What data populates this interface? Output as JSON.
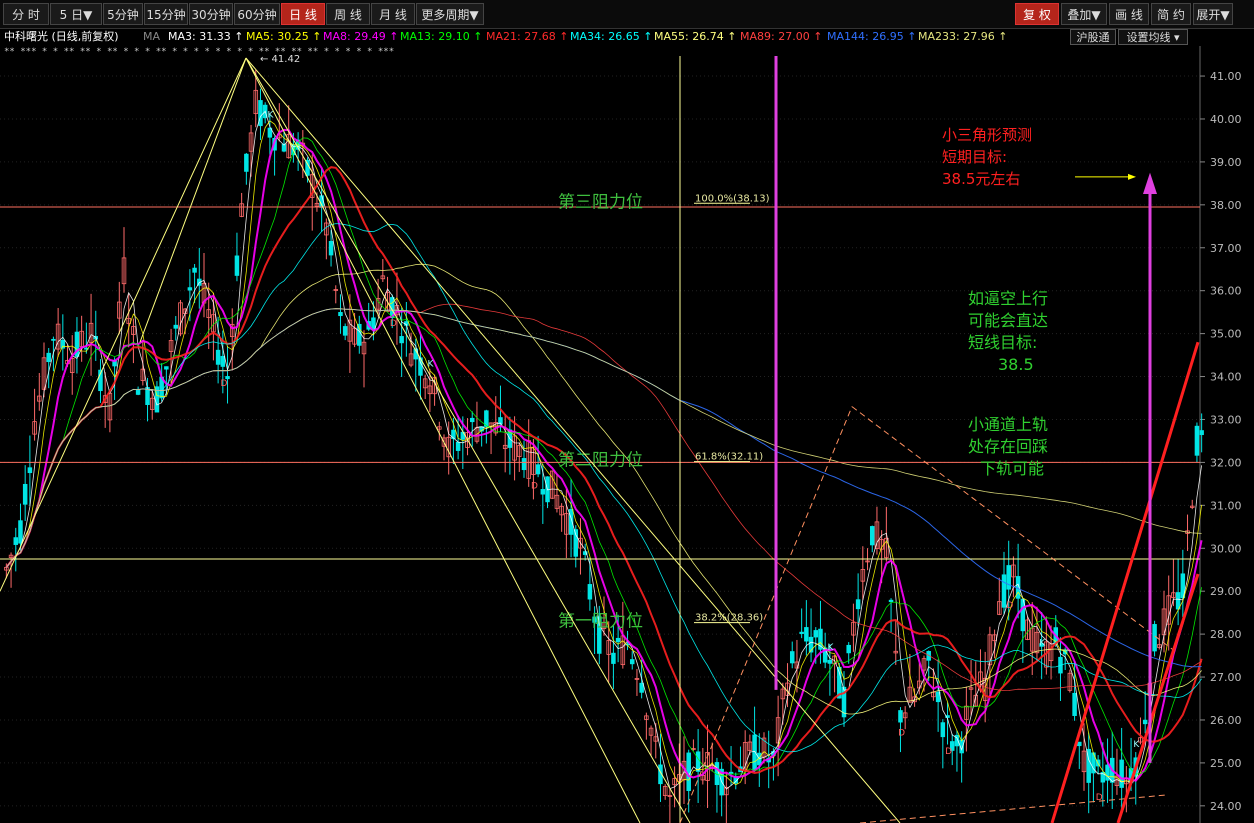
{
  "toolbar": {
    "periods": [
      "分 时",
      "5 日▼",
      "5分钟",
      "15分钟",
      "30分钟",
      "60分钟",
      "日 线",
      "周 线",
      "月 线",
      "更多周期▼"
    ],
    "active_period": "日 线",
    "right_buttons": [
      "复 权",
      "叠加▼",
      "画 线",
      "简 约",
      "展开▼"
    ]
  },
  "ma_bar": {
    "stock": "中科曙光 (日线,前复权)",
    "ma_label": "MA",
    "items": [
      {
        "text": "MA3: 31.33",
        "color": "#ffffff"
      },
      {
        "text": "MA5: 30.25",
        "color": "#ffff00"
      },
      {
        "text": "MA8: 29.49",
        "color": "#ff00ff"
      },
      {
        "text": "MA13: 29.10",
        "color": "#00ff00"
      },
      {
        "text": "MA21: 27.68",
        "color": "#ff2a2a"
      },
      {
        "text": "MA34: 26.65",
        "color": "#00ffff"
      },
      {
        "text": "MA55: 26.74",
        "color": "#ffff80"
      },
      {
        "text": "MA89: 27.00",
        "color": "#ff4040"
      },
      {
        "text": "MA144: 26.95",
        "color": "#3070ff"
      },
      {
        "text": "MA233: 27.96",
        "color": "#e6e680"
      }
    ],
    "arrow": "↑",
    "buttons": [
      "沪股通",
      "设置均线"
    ]
  },
  "price_axis": {
    "ticks": [
      "41.00",
      "40.00",
      "39.00",
      "38.00",
      "37.00",
      "36.00",
      "35.00",
      "34.00",
      "33.00",
      "32.00",
      "31.00",
      "30.00",
      "29.00",
      "28.00",
      "27.00",
      "26.00",
      "25.00",
      "24.00"
    ],
    "range": [
      23.6,
      41.7
    ]
  },
  "chart_data": {
    "type": "candlestick",
    "peak_label": "41.42",
    "fib_levels": [
      {
        "label": "第三阻力位",
        "ratio": "100.0%(38.13)",
        "price": 38.13
      },
      {
        "label": "第二阻力位",
        "ratio": "61.8%(32.11)",
        "price": 32.11
      },
      {
        "label": "第一阻力位",
        "ratio": "38.2%(28.36)",
        "price": 28.36
      }
    ],
    "horizontal_lines": [
      {
        "price": 37.95,
        "color": "#ff7060"
      },
      {
        "price": 32.0,
        "color": "#ff7060"
      },
      {
        "price": 29.75,
        "color": "#ffff99"
      }
    ],
    "close_path": [
      [
        0,
        29.5
      ],
      [
        3,
        30.5
      ],
      [
        6,
        33
      ],
      [
        10,
        35
      ],
      [
        14,
        34.5
      ],
      [
        18,
        35
      ],
      [
        22,
        33.2
      ],
      [
        25,
        36.5
      ],
      [
        28,
        34
      ],
      [
        32,
        33.5
      ],
      [
        36,
        35
      ],
      [
        40,
        36.5
      ],
      [
        44,
        35
      ],
      [
        47,
        34
      ],
      [
        50,
        38
      ],
      [
        53,
        40.3
      ],
      [
        56,
        39.8
      ],
      [
        59,
        39.5
      ],
      [
        62,
        39.3
      ],
      [
        65,
        38.5
      ],
      [
        68,
        37.5
      ],
      [
        71,
        35.2
      ],
      [
        74,
        34.8
      ],
      [
        77,
        35
      ],
      [
        80,
        36.2
      ],
      [
        83,
        35.5
      ],
      [
        86,
        34.7
      ],
      [
        90,
        34
      ],
      [
        94,
        32.3
      ],
      [
        98,
        32.7
      ],
      [
        102,
        33
      ],
      [
        106,
        32.5
      ],
      [
        110,
        32.2
      ],
      [
        114,
        31.7
      ],
      [
        118,
        31
      ],
      [
        122,
        30
      ],
      [
        126,
        28
      ],
      [
        129,
        27.5
      ],
      [
        132,
        27.8
      ],
      [
        135,
        27
      ],
      [
        138,
        25.2
      ],
      [
        141,
        24.1
      ],
      [
        144,
        24.7
      ],
      [
        147,
        25
      ],
      [
        150,
        24.9
      ],
      [
        153,
        24.6
      ],
      [
        156,
        25
      ],
      [
        160,
        25.3
      ],
      [
        163,
        25
      ],
      [
        166,
        27
      ],
      [
        169,
        27.8
      ],
      [
        172,
        27.9
      ],
      [
        175,
        27.4
      ],
      [
        178,
        26.5
      ],
      [
        181,
        29
      ],
      [
        184,
        30.4
      ],
      [
        187,
        29.8
      ],
      [
        190,
        26.2
      ],
      [
        193,
        26.5
      ],
      [
        196,
        27.3
      ],
      [
        199,
        26
      ],
      [
        202,
        25.3
      ],
      [
        205,
        26.4
      ],
      [
        208,
        26.9
      ],
      [
        211,
        28.9
      ],
      [
        214,
        29.3
      ],
      [
        217,
        28.1
      ],
      [
        220,
        27.5
      ],
      [
        223,
        27.8
      ],
      [
        226,
        27
      ],
      [
        229,
        25
      ],
      [
        232,
        24.7
      ],
      [
        235,
        24.9
      ],
      [
        238,
        24.6
      ],
      [
        241,
        25.4
      ],
      [
        244,
        27.8
      ],
      [
        247,
        28.5
      ],
      [
        250,
        29
      ],
      [
        253,
        32.5
      ]
    ],
    "highlights": [
      {
        "bar": 56,
        "label": "K"
      },
      {
        "bar": 90,
        "label": "K"
      },
      {
        "bar": 175,
        "label": "K"
      },
      {
        "bar": 220,
        "label": "K"
      },
      {
        "bar": 240,
        "label": "K"
      }
    ],
    "lows": [
      {
        "bar": 46,
        "label": "D"
      },
      {
        "bar": 82,
        "label": "D"
      },
      {
        "bar": 112,
        "label": "D"
      },
      {
        "bar": 190,
        "label": "D"
      },
      {
        "bar": 200,
        "label": "D"
      },
      {
        "bar": 213,
        "label": "D"
      },
      {
        "bar": 232,
        "label": "D"
      }
    ]
  },
  "annotations": {
    "triangle_forecast": [
      "小三角形预测",
      "短期目标:",
      "38.5元左右"
    ],
    "squeeze": [
      "如逼空上行",
      "可能会直达",
      "短线目标:",
      "38.5"
    ],
    "channel": [
      "小通道上轨",
      "处存在回踩",
      "下轨可能"
    ]
  },
  "colors": {
    "up": "#ff6a6a",
    "down": "#00e5e5",
    "fib_text": "#3fbf3f",
    "annot_red": "#ff2020",
    "annot_green": "#30d030",
    "magenta": "#e040e0",
    "red_line": "#ff2020"
  }
}
